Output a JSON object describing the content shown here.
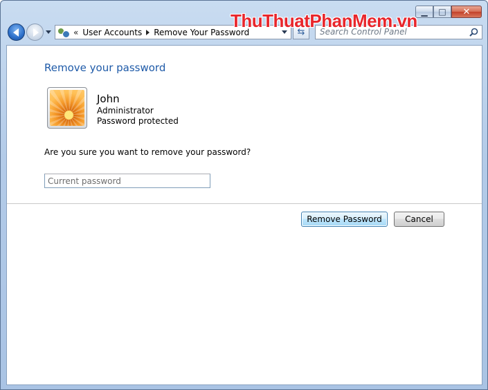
{
  "window": {
    "caption_buttons": {
      "minimize": "▁",
      "maximize": "□",
      "close": "✕"
    }
  },
  "watermark": {
    "part1": "ThuThuat",
    "part2": "PhanMem",
    "part3": ".vn"
  },
  "address": {
    "chevron": "«",
    "crumbs": [
      "User Accounts",
      "Remove Your Password"
    ]
  },
  "search": {
    "placeholder": "Search Control Panel"
  },
  "page": {
    "title": "Remove your password",
    "user": {
      "name": "John",
      "role": "Administrator",
      "status": "Password protected"
    },
    "question": "Are you sure you want to remove your password?",
    "password_placeholder": "Current password",
    "buttons": {
      "remove": "Remove Password",
      "cancel": "Cancel"
    }
  },
  "icons": {
    "back": "back-arrow-icon",
    "forward": "forward-arrow-icon",
    "address": "user-accounts-icon",
    "search": "search-icon"
  },
  "colors": {
    "title": "#1e5aa8",
    "watermark_red": "#e8262c",
    "close_red": "#c2412a"
  }
}
